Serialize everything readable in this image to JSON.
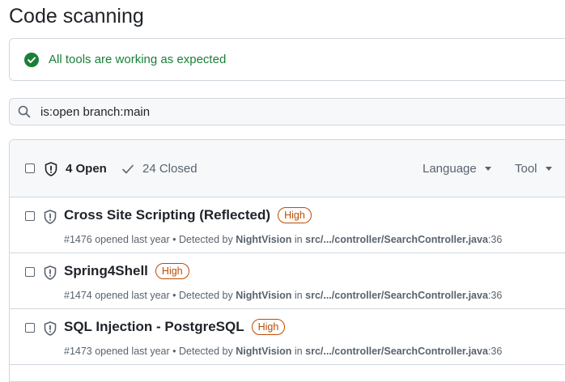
{
  "page": {
    "title": "Code scanning"
  },
  "status": {
    "message": "All tools are working as expected",
    "color": "#1a7f37"
  },
  "search": {
    "value": "is:open branch:main"
  },
  "list_header": {
    "open_label": "4 Open",
    "closed_label": "24 Closed",
    "filters": [
      "Language",
      "Tool"
    ]
  },
  "alerts": [
    {
      "title": "Cross Site Scripting (Reflected)",
      "severity": "High",
      "opened": "#1476 opened last year",
      "detected_prefix": "Detected by",
      "tool": "NightVision",
      "in": "in",
      "path": "src/.../controller/SearchController.java",
      "line": ":36"
    },
    {
      "title": "Spring4Shell",
      "severity": "High",
      "opened": "#1474 opened last year",
      "detected_prefix": "Detected by",
      "tool": "NightVision",
      "in": "in",
      "path": "src/.../controller/SearchController.java",
      "line": ":36"
    },
    {
      "title": "SQL Injection - PostgreSQL",
      "severity": "High",
      "opened": "#1473 opened last year",
      "detected_prefix": "Detected by",
      "tool": "NightVision",
      "in": "in",
      "path": "src/.../controller/SearchController.java",
      "line": ":36"
    }
  ],
  "colors": {
    "severity_high": "#bc4c00",
    "border": "#d0d7de",
    "header_bg": "#f6f8fa"
  }
}
